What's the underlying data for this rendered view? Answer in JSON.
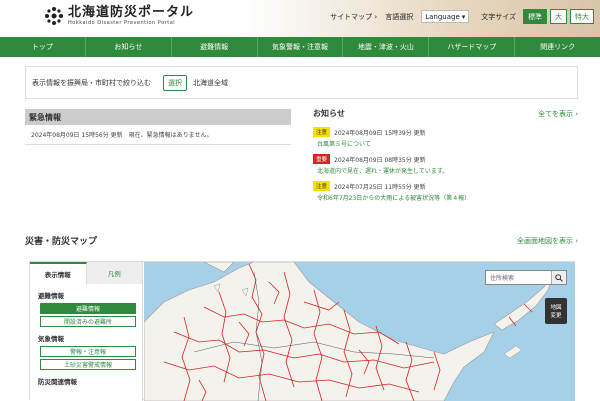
{
  "header": {
    "logo_main": "北海道防災ポータル",
    "logo_sub": "Hokkaido Disaster Prevention Portal",
    "sitemap": "サイトマップ ›",
    "language_label": "言語選択",
    "language_value": "Language",
    "fontsize_label": "文字サイズ",
    "fs_standard": "標準",
    "fs_large": "大",
    "fs_xlarge": "特大"
  },
  "nav": [
    "トップ",
    "お知らせ",
    "避難情報",
    "気象警報・注意報",
    "地震・津波・火山",
    "ハザードマップ",
    "関連リンク"
  ],
  "filter": {
    "label": "表示情報を振興局・市町村で絞り込む",
    "button": "選択",
    "value": "北海道全域"
  },
  "emergency": {
    "title": "緊急情報",
    "body": "2024年08月09日 15時56分 更新　現在、緊急情報はありません。"
  },
  "news": {
    "title": "お知らせ",
    "show_all": "全てを表示 ›",
    "items": [
      {
        "badge": "注意",
        "time": "2024年08月09日 15時39分 更新",
        "text": "台風第５号について"
      },
      {
        "badge": "重要",
        "time": "2024年08月09日 08時35分 更新",
        "text": "北海道内で見在、遅れ・運休が発生しています。"
      },
      {
        "badge": "注意",
        "time": "2024年07月25日 11時55分 更新",
        "text": "令和6年7月23日からの大雨による被害状況等（第４報）"
      }
    ]
  },
  "map": {
    "title": "災害・防災マップ",
    "full_link": "全画面地図を表示 ›",
    "tab_display": "表示情報",
    "tab_legend": "凡例",
    "group_evac": "避難情報",
    "btn_evac": "避難情報",
    "btn_shelters": "開設済みの避難所",
    "group_weather": "気象情報",
    "btn_warnings": "警報・注意報",
    "btn_landslide": "土砂災害警戒情報",
    "group_related": "防災関連情報",
    "search_placeholder": "住所検索",
    "layer_line1": "地図",
    "layer_line2": "変更"
  },
  "colors": {
    "brand_green": "#2f8a3c",
    "alert_red": "#d8231f",
    "warn_yellow": "#f5e000",
    "sea": "#a6cfe8"
  }
}
